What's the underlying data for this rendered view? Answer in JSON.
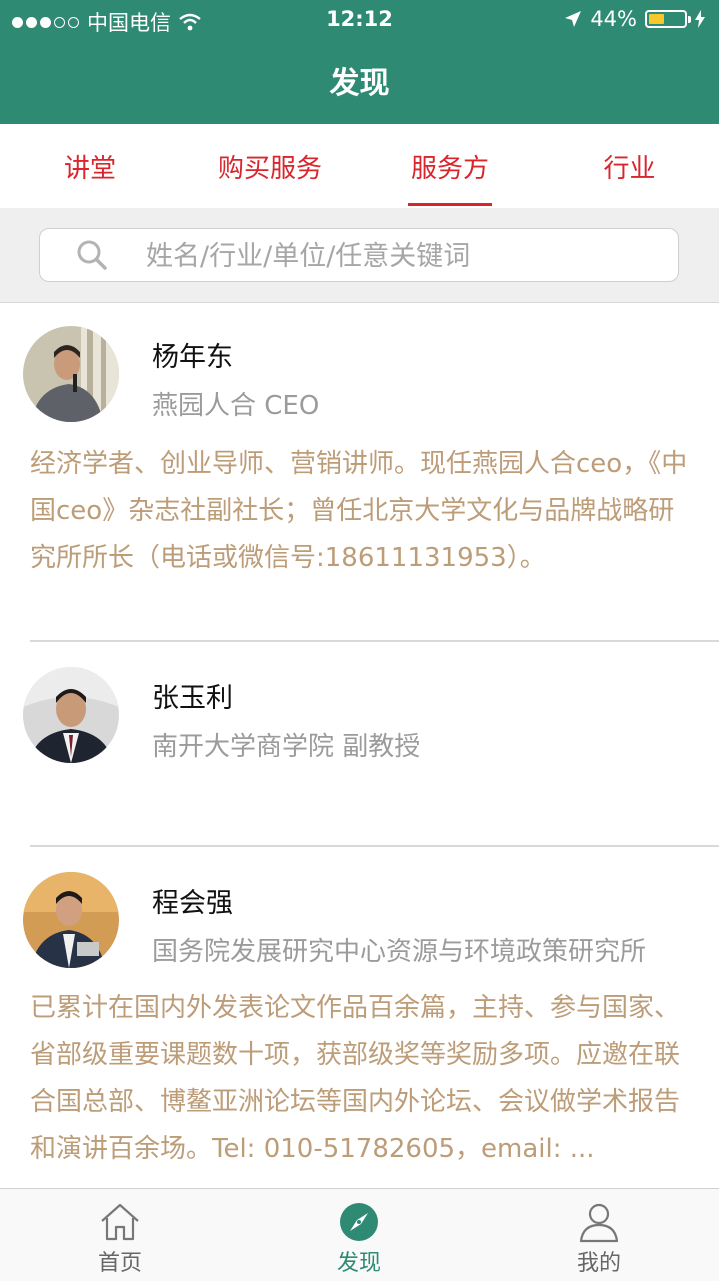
{
  "status_bar": {
    "carrier": "中国电信",
    "time": "12:12",
    "battery": "44%",
    "battery_level": 0.44
  },
  "header": {
    "title": "发现"
  },
  "tabs": [
    {
      "label": "讲堂",
      "active": false
    },
    {
      "label": "购买服务",
      "active": false
    },
    {
      "label": "服务方",
      "active": true
    },
    {
      "label": "行业",
      "active": false
    }
  ],
  "search": {
    "placeholder": "姓名/行业/单位/任意关键词",
    "value": ""
  },
  "people": [
    {
      "name": "杨年东",
      "title": "燕园人合 CEO",
      "desc": "经济学者、创业导师、营销讲师。现任燕园人合ceo，《中国ceo》杂志社副社长；曾任北京大学文化与品牌战略研究所所长（电话或微信号:18611131953）。"
    },
    {
      "name": "张玉利",
      "title": "南开大学商学院 副教授",
      "desc": ""
    },
    {
      "name": "程会强",
      "title": "国务院发展研究中心资源与环境政策研究所",
      "desc": "已累计在国内外发表论文作品百余篇，主持、参与国家、省部级重要课题数十项，获部级奖等奖励多项。应邀在联合国总部、博鳌亚洲论坛等国内外论坛、会议做学术报告和演讲百余场。Tel: 010-51782605，email: ..."
    }
  ],
  "tabbar": [
    {
      "label": "首页",
      "icon": "home-icon",
      "active": false
    },
    {
      "label": "发现",
      "icon": "compass-icon",
      "active": true
    },
    {
      "label": "我的",
      "icon": "person-icon",
      "active": false
    }
  ],
  "colors": {
    "header_bg": "#2f8a73",
    "tab_accent": "#d9252b",
    "desc_text": "#bd9c78",
    "active_tab": "#2f8a73"
  }
}
